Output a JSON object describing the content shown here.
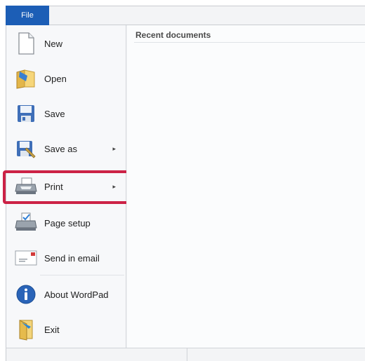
{
  "ribbon": {
    "file_tab": "File"
  },
  "menu": {
    "items": [
      {
        "label": "New",
        "icon": "new-document-icon"
      },
      {
        "label": "Open",
        "icon": "open-folder-icon"
      },
      {
        "label": "Save",
        "icon": "floppy-disk-icon"
      },
      {
        "label": "Save as",
        "icon": "save-as-icon",
        "has_submenu": true
      },
      {
        "label": "Print",
        "icon": "printer-icon",
        "has_submenu": true
      },
      {
        "label": "Page setup",
        "icon": "page-setup-icon"
      },
      {
        "label": "Send in email",
        "icon": "email-envelope-icon"
      },
      {
        "label": "About WordPad",
        "icon": "info-icon"
      },
      {
        "label": "Exit",
        "icon": "exit-door-icon"
      }
    ],
    "submenu_arrow": "▸"
  },
  "recent": {
    "header": "Recent documents"
  },
  "colors": {
    "file_tab": "#1c5eb6",
    "highlight": "#cc2246"
  }
}
